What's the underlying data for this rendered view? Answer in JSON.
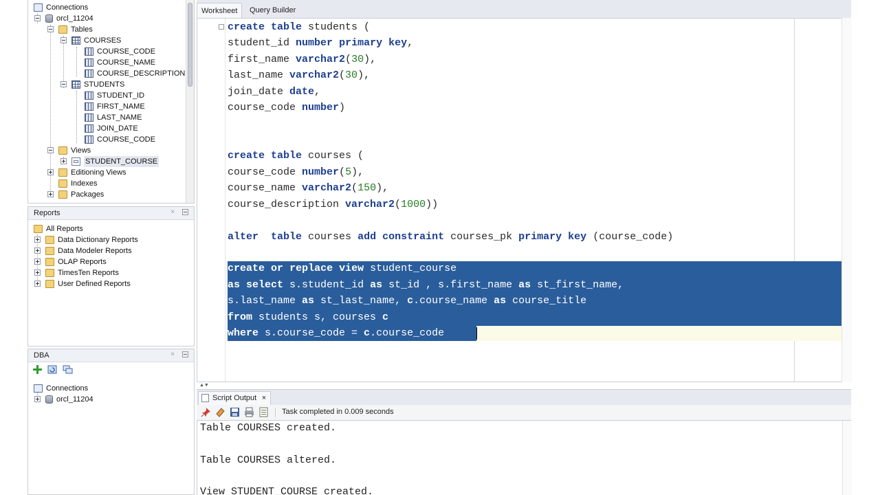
{
  "connections_panel": {
    "items": [
      {
        "label": "Connections"
      },
      {
        "label": "orcl_11204"
      },
      {
        "label": "Tables"
      },
      {
        "label": "COURSES"
      },
      {
        "label": "COURSE_CODE"
      },
      {
        "label": "COURSE_NAME"
      },
      {
        "label": "COURSE_DESCRIPTION"
      },
      {
        "label": "STUDENTS"
      },
      {
        "label": "STUDENT_ID"
      },
      {
        "label": "FIRST_NAME"
      },
      {
        "label": "LAST_NAME"
      },
      {
        "label": "JOIN_DATE"
      },
      {
        "label": "COURSE_CODE"
      },
      {
        "label": "Views"
      },
      {
        "label": "STUDENT_COURSE"
      },
      {
        "label": "Editioning Views"
      },
      {
        "label": "Indexes"
      },
      {
        "label": "Packages"
      }
    ]
  },
  "reports_panel": {
    "title": "Reports",
    "close": "×",
    "items": [
      {
        "label": "All Reports"
      },
      {
        "label": "Data Dictionary Reports"
      },
      {
        "label": "Data Modeler Reports"
      },
      {
        "label": "OLAP Reports"
      },
      {
        "label": "TimesTen Reports"
      },
      {
        "label": "User Defined Reports"
      }
    ]
  },
  "dba_panel": {
    "title": "DBA",
    "close": "×",
    "items": [
      {
        "label": "Connections"
      },
      {
        "label": "orcl_11204"
      }
    ]
  },
  "editor_tabs": {
    "worksheet": "Worksheet",
    "query_builder": "Query Builder"
  },
  "output": {
    "tab_label": "Script Output",
    "tab_close": "×",
    "status": "Task completed in 0.009 seconds",
    "lines": [
      "Table COURSES created.",
      "",
      "Table COURSES altered.",
      "",
      "View STUDENT_COURSE created."
    ]
  },
  "colors": {
    "selection": "#2a5d9b",
    "keyword": "#1d3f8f",
    "number": "#277a27"
  }
}
